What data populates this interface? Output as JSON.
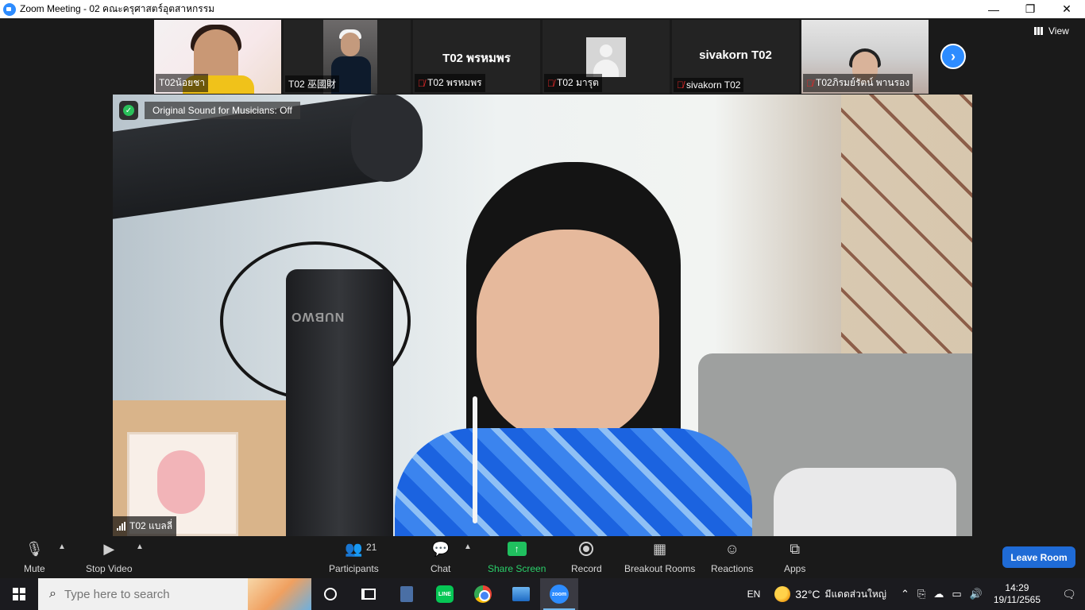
{
  "window": {
    "title": "Zoom Meeting - 02 คณะครุศาสตร์อุตสาหกรรม",
    "minimize": "—",
    "maximize": "❐",
    "close": "✕"
  },
  "top": {
    "view_label": "View",
    "next_icon": "chevron-right-icon"
  },
  "participants_strip": [
    {
      "name": "T02น้อยชา",
      "muted": false,
      "video": true
    },
    {
      "name": "T02 巫國財",
      "muted": false,
      "video": true
    },
    {
      "name": "T02 พรหมพร",
      "display_name": "T02 พรหมพร",
      "muted": true,
      "video": false
    },
    {
      "name": "T02 มารุต",
      "muted": true,
      "video": false,
      "avatar": "default-avatar"
    },
    {
      "name": "sivakorn T02",
      "display_name": "sivakorn T02",
      "muted": true,
      "video": false
    },
    {
      "name": "T02ภิรมย์รัตน์ พานรอง",
      "muted": true,
      "video": true
    }
  ],
  "main_video": {
    "sound_label": "Original Sound for Musicians: Off",
    "speaker_name": "T02 แบลลี่",
    "mic_brand": "NUBWO"
  },
  "toolbar": {
    "mute": "Mute",
    "stop_video": "Stop Video",
    "participants": "Participants",
    "participants_count": "21",
    "chat": "Chat",
    "share_screen": "Share Screen",
    "record": "Record",
    "breakout_rooms": "Breakout Rooms",
    "reactions": "Reactions",
    "apps": "Apps",
    "leave": "Leave Room"
  },
  "taskbar": {
    "search_placeholder": "Type here to search",
    "line_label": "LINE",
    "zoom_label": "zoom",
    "language": "EN",
    "temperature": "32°C",
    "weather_text": "มีแดดส่วนใหญ่",
    "time": "14:29",
    "date": "19/11/2565"
  },
  "colors": {
    "accent": "#2d8cff",
    "share_green": "#20c05f",
    "leave_blue": "#1f6bd6",
    "muted_red": "#e02828"
  }
}
